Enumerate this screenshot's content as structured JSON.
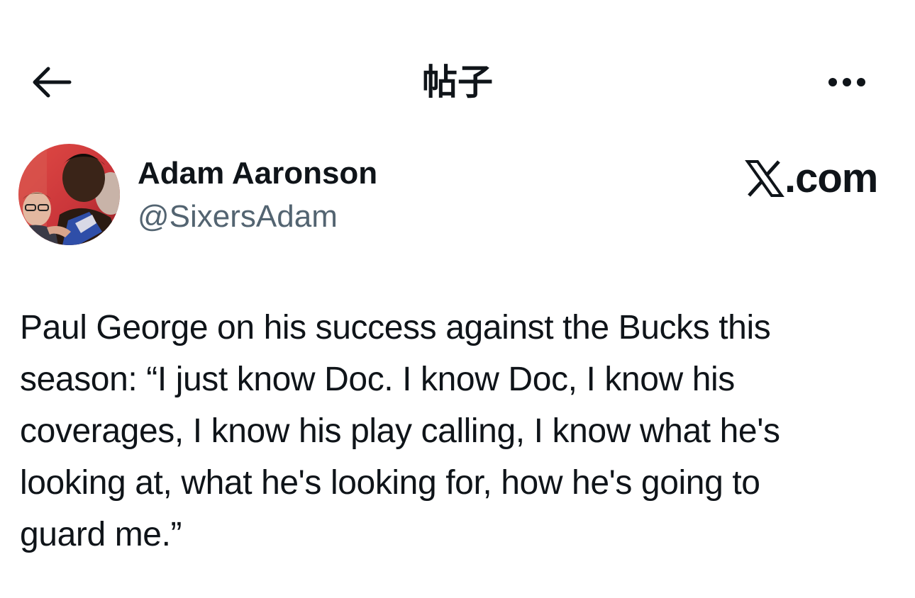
{
  "header": {
    "title": "帖子",
    "back_icon": "arrow-left-icon",
    "more_icon": "more-horizontal-icon"
  },
  "author": {
    "name": "Adam Aaronson",
    "handle": "@SixersAdam",
    "avatar": "profile-photo"
  },
  "source": {
    "label": ".com",
    "logo": "x-logo-icon"
  },
  "tweet": {
    "text": "Paul George on his success against the Bucks this\nseason: “I just know Doc. I know Doc, I know his\ncoverages, I know his play calling, I know what he's\nlooking at, what he's looking for, how he's going to\nguard me.”"
  },
  "colors": {
    "text_primary": "#0f1419",
    "text_secondary": "#536471",
    "background": "#ffffff"
  }
}
